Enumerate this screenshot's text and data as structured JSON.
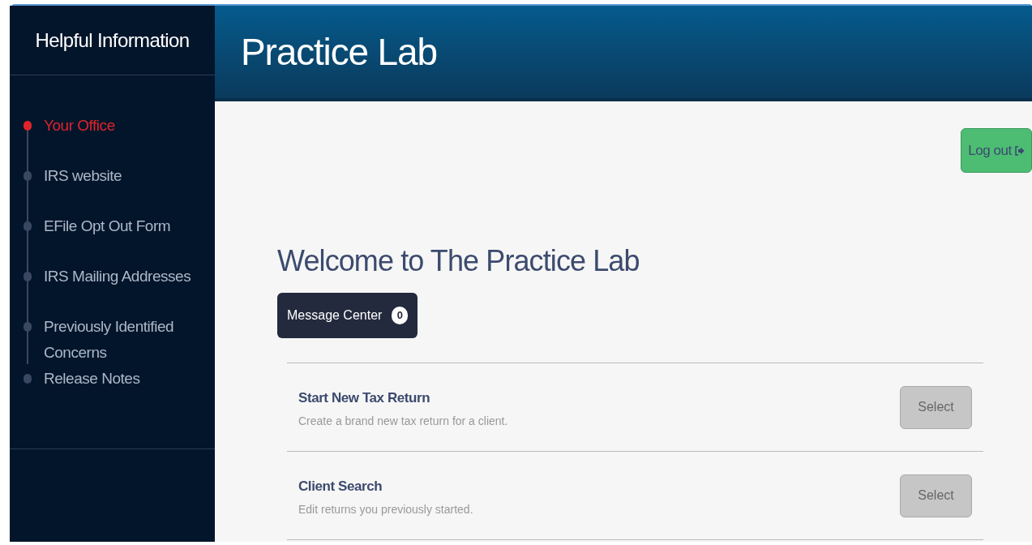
{
  "sidebar": {
    "title": "Helpful Information",
    "items": [
      {
        "label": "Your Office",
        "selected": true
      },
      {
        "label": "IRS website",
        "selected": false
      },
      {
        "label": "EFile Opt Out Form",
        "selected": false
      },
      {
        "label": "IRS Mailing Addresses",
        "selected": false
      },
      {
        "label": "Previously Identified Concerns",
        "selected": false
      },
      {
        "label": "Release Notes",
        "selected": false
      }
    ]
  },
  "header": {
    "title": "Practice Lab"
  },
  "logout_button": {
    "label": "Log out"
  },
  "welcome": {
    "title": "Welcome to The Practice Lab"
  },
  "message_center": {
    "label": "Message Center",
    "count": "0"
  },
  "actions": [
    {
      "title": "Start New Tax Return",
      "description": "Create a brand new tax return for a client.",
      "button": "Select"
    },
    {
      "title": "Client Search",
      "description": "Edit returns you previously started.",
      "button": "Select"
    }
  ]
}
